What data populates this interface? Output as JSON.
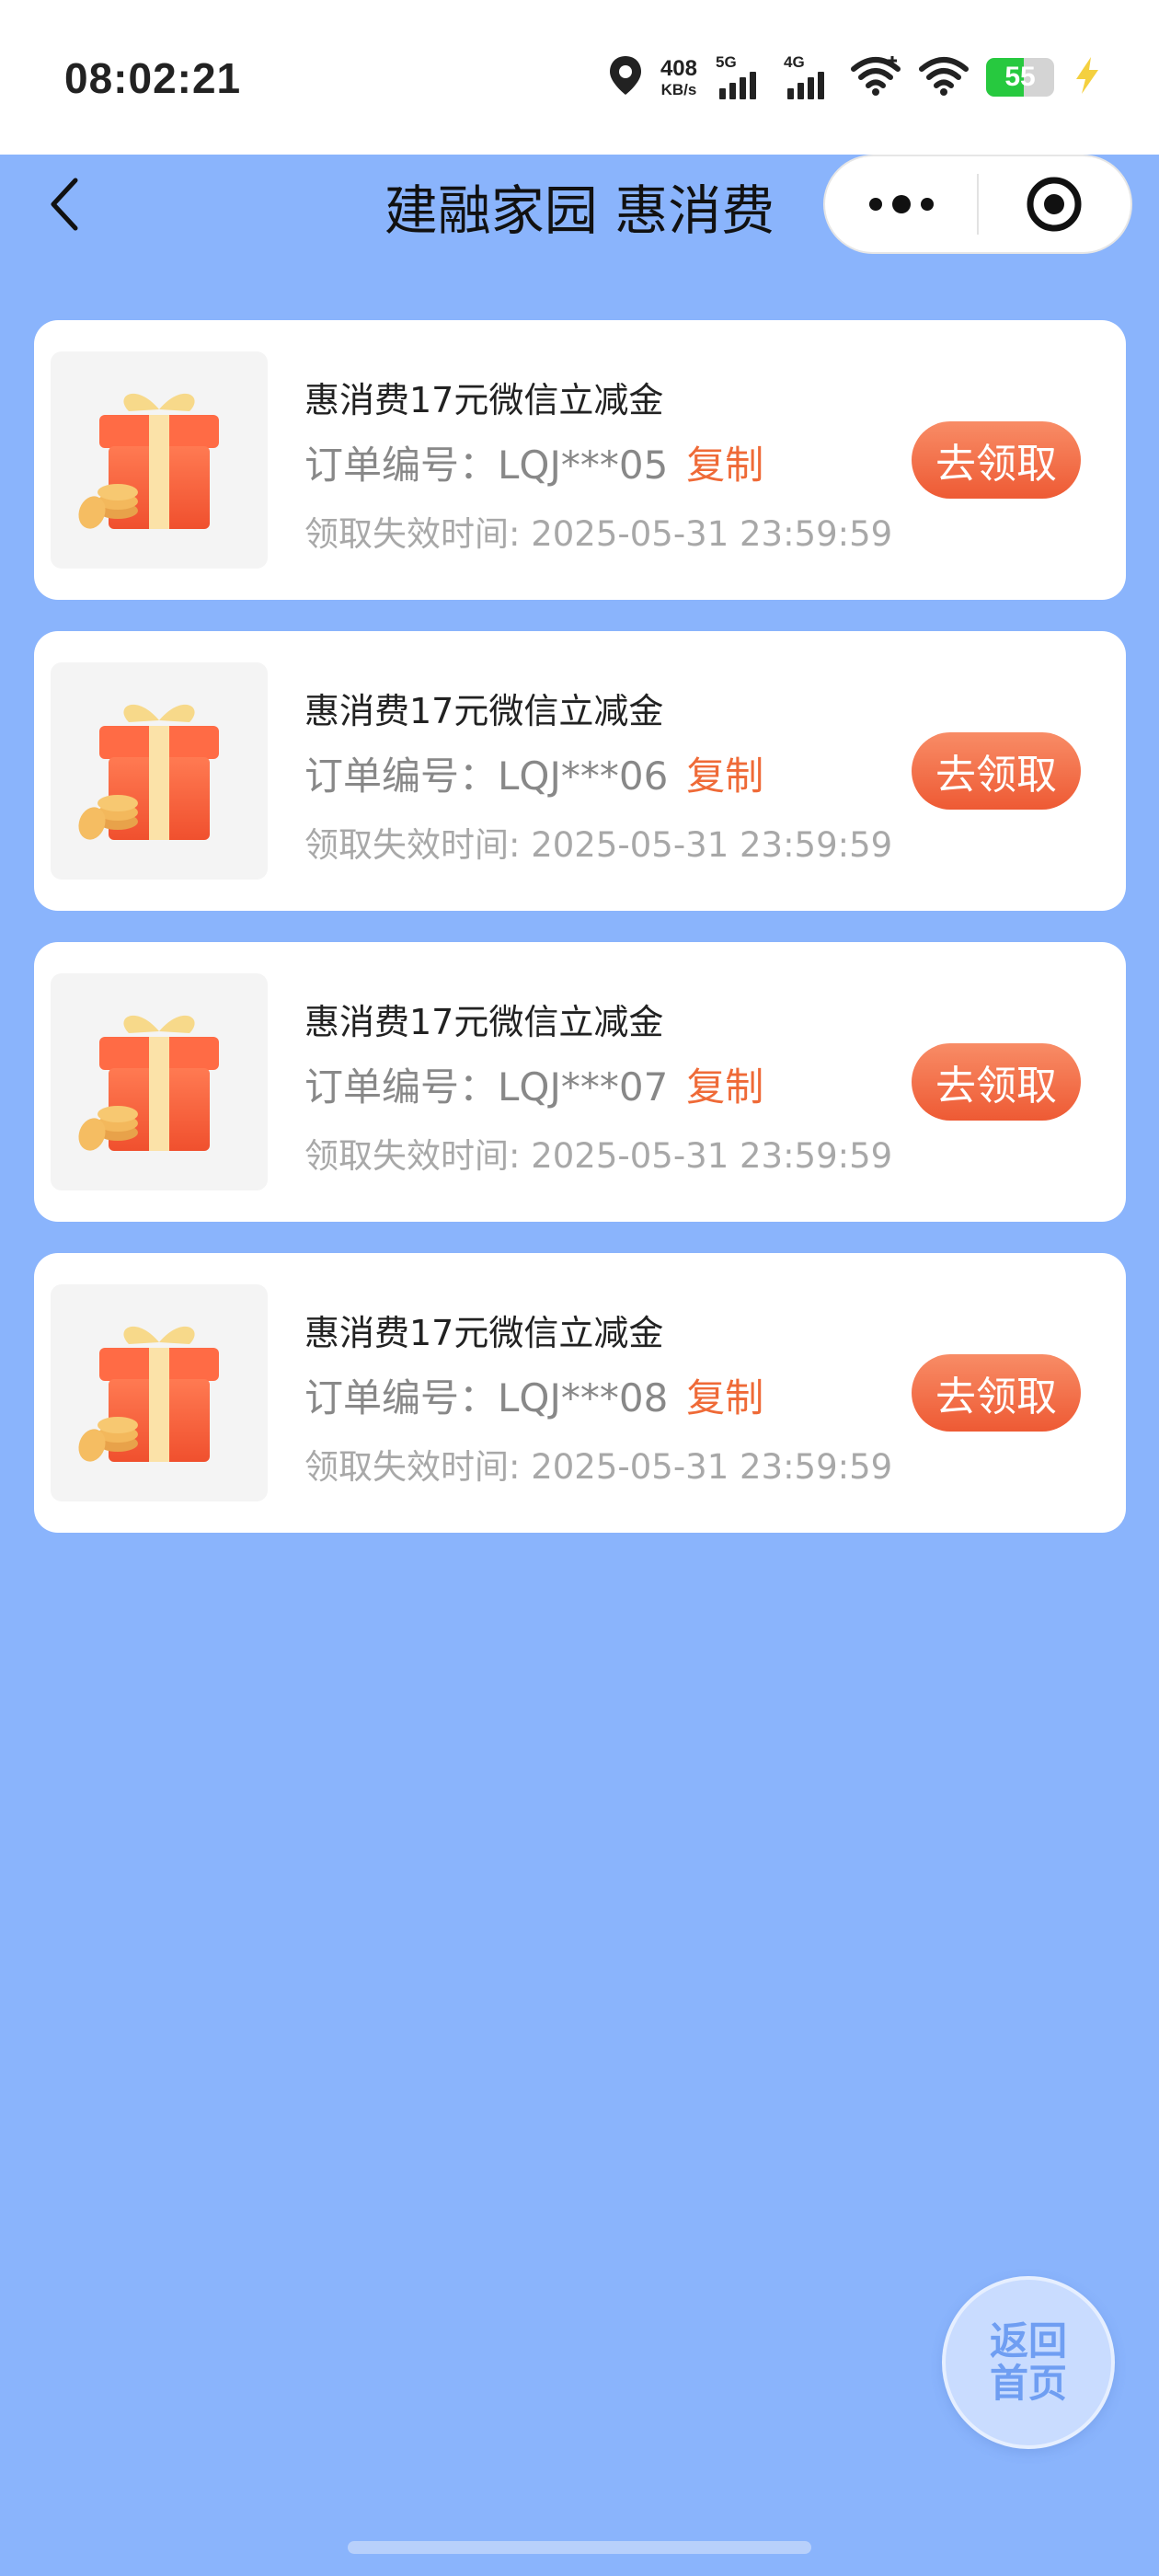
{
  "status_bar": {
    "time": "08:02:21",
    "net_speed_value": "408",
    "net_speed_unit": "KB/s",
    "sim1_label": "5G",
    "sim2_label": "4G",
    "battery": "55"
  },
  "nav": {
    "title": "建融家园 惠消费"
  },
  "cards": [
    {
      "title": "惠消费17元微信立减金",
      "order": "订单编号：LQJ***05",
      "copy": "复制",
      "expire": "领取失效时间: 2025-05-31 23:59:59",
      "button": "去领取"
    },
    {
      "title": "惠消费17元微信立减金",
      "order": "订单编号：LQJ***06",
      "copy": "复制",
      "expire": "领取失效时间: 2025-05-31 23:59:59",
      "button": "去领取"
    },
    {
      "title": "惠消费17元微信立减金",
      "order": "订单编号：LQJ***07",
      "copy": "复制",
      "expire": "领取失效时间: 2025-05-31 23:59:59",
      "button": "去领取"
    },
    {
      "title": "惠消费17元微信立减金",
      "order": "订单编号：LQJ***08",
      "copy": "复制",
      "expire": "领取失效时间: 2025-05-31 23:59:59",
      "button": "去领取"
    }
  ],
  "home_button": {
    "line1": "返回",
    "line2": "首页"
  },
  "colors": {
    "background": "#8ab4fc",
    "accent": "#ef6a37",
    "button": "#ee5a34"
  },
  "icons": {
    "card_thumb": "gift-box-with-coins-icon",
    "location": "location-pin-icon",
    "wifi": "wifi-icon",
    "back": "chevron-left-icon",
    "more": "more-dots-icon",
    "close": "target-circle-icon"
  }
}
